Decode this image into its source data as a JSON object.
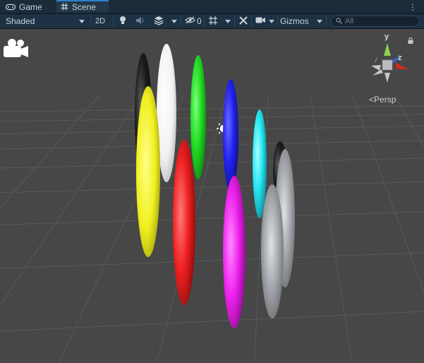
{
  "tabs": [
    {
      "label": "Game",
      "icon": "gamepad-icon",
      "active": false
    },
    {
      "label": "Scene",
      "icon": "grid-hash-icon",
      "active": true
    }
  ],
  "toolbar": {
    "shading_mode": "Shaded",
    "mode_2d": "2D",
    "hidden_count": "0",
    "gizmos_label": "Gizmos",
    "search_placeholder": "All"
  },
  "viewport": {
    "projection_label": "Persp",
    "gizmo_axes": {
      "y": "y",
      "z": "z"
    },
    "background_color": "#474747"
  },
  "colors": {
    "accent": "#2f7fd0",
    "capsules": [
      "#1a1a1a",
      "#ffffff",
      "#22dd22",
      "#2222ee",
      "#22e6f0",
      "#1a1a1a",
      "#f0f020",
      "#ee2020",
      "#ee22ee",
      "#a0a4a8",
      "#a0a4a8"
    ]
  }
}
